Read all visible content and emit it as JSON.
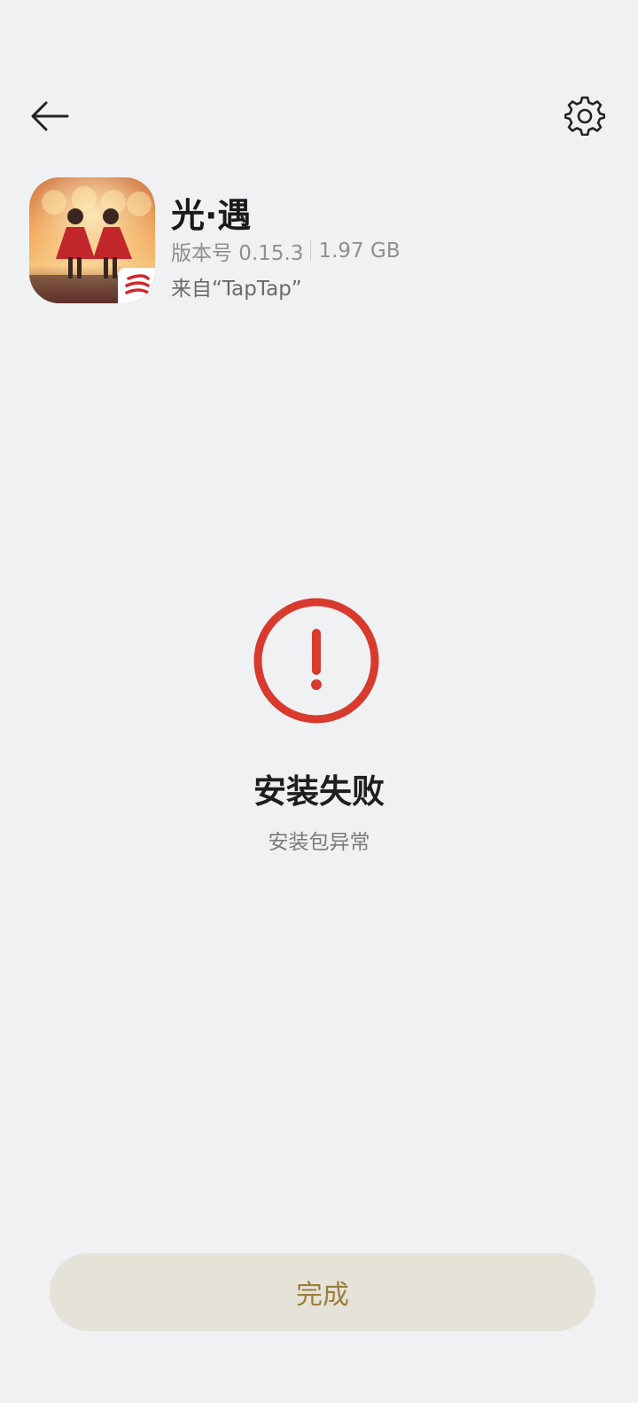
{
  "header": {
    "back_icon": "arrow-left-icon",
    "settings_icon": "gear-icon"
  },
  "app": {
    "name": "光·遇",
    "version": "版本号 0.15.3",
    "size": "1.97 GB",
    "source": "来自“TapTap”",
    "icon": "app-icon"
  },
  "status": {
    "icon": "exclamation-circle-icon",
    "title": "安装失败",
    "message": "安装包异常",
    "color": "#d93a2e"
  },
  "actions": {
    "done_label": "完成",
    "done_color": "#9b7e3c",
    "done_bg": "#e5e2d8"
  }
}
